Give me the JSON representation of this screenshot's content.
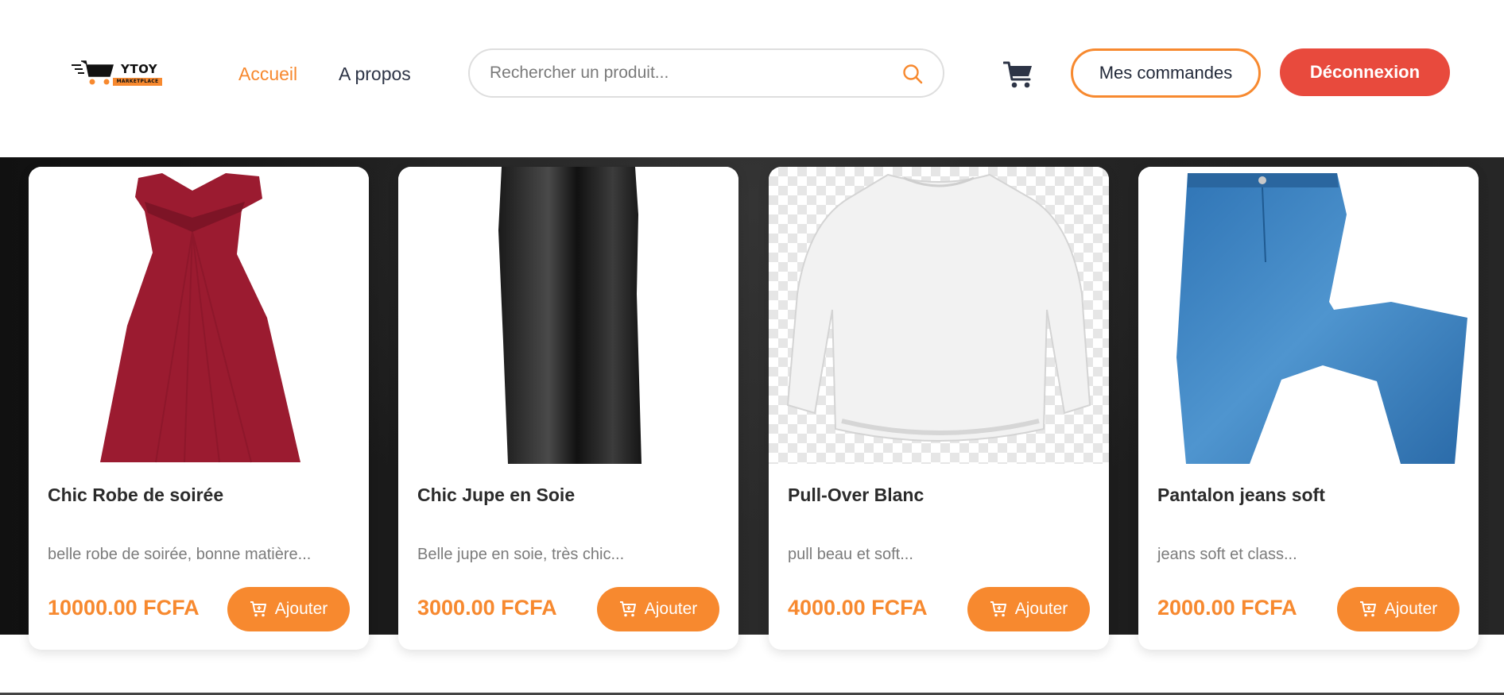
{
  "brand": {
    "name": "YTOY",
    "tagline": "MARKETPLACE"
  },
  "nav": {
    "items": [
      {
        "label": "Accueil",
        "active": true
      },
      {
        "label": "A propos",
        "active": false
      }
    ]
  },
  "search": {
    "placeholder": "Rechercher un produit...",
    "value": ""
  },
  "header_actions": {
    "orders_label": "Mes commandes",
    "logout_label": "Déconnexion"
  },
  "colors": {
    "accent": "#f7892f",
    "danger": "#e84a3d",
    "text_dark": "#2d3446"
  },
  "products": [
    {
      "name": "Chic Robe de soirée",
      "description": "belle robe de soirée, bonne matière...",
      "price": "10000.00 FCFA",
      "add_label": "Ajouter",
      "image": "red-dress"
    },
    {
      "name": "Chic Jupe en Soie",
      "description": "Belle jupe en soie, très chic...",
      "price": "3000.00 FCFA",
      "add_label": "Ajouter",
      "image": "black-silk-skirt"
    },
    {
      "name": "Pull-Over Blanc",
      "description": "pull beau et soft...",
      "price": "4000.00 FCFA",
      "add_label": "Ajouter",
      "image": "white-sweater"
    },
    {
      "name": "Pantalon jeans soft",
      "description": "jeans soft et class...",
      "price": "2000.00 FCFA",
      "add_label": "Ajouter",
      "image": "blue-jeans"
    }
  ]
}
